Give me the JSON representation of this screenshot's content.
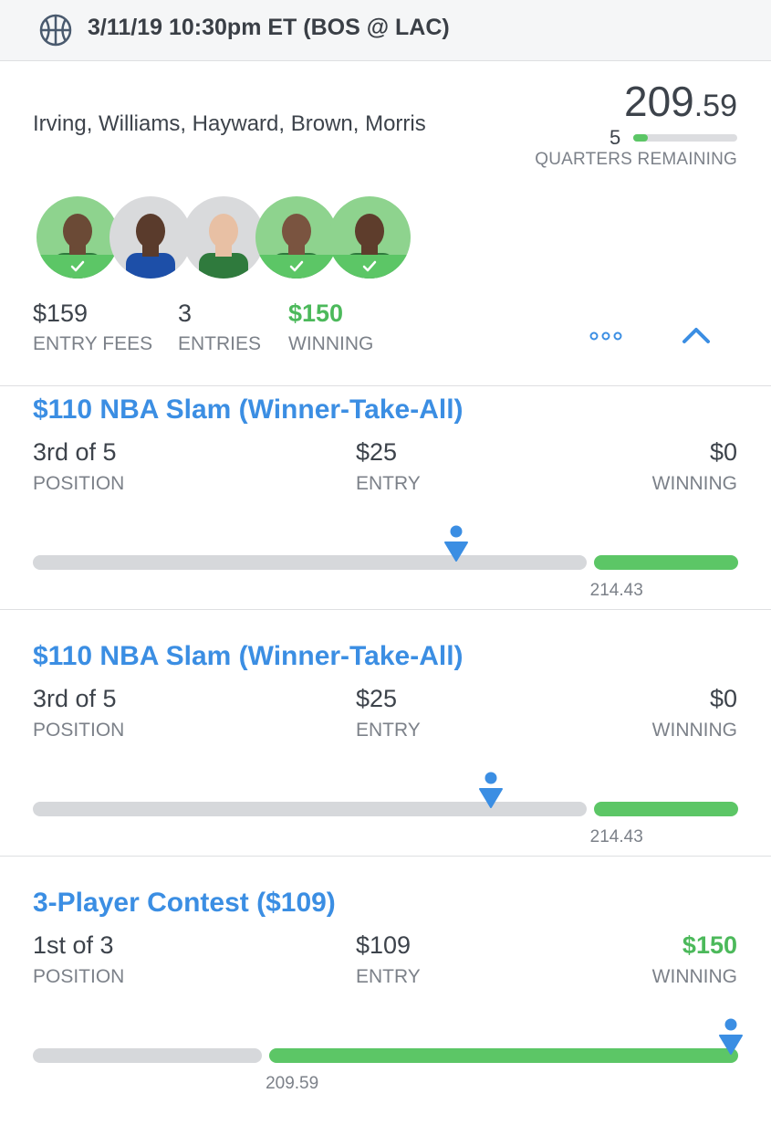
{
  "header": {
    "title": "3/11/19 10:30pm ET (BOS @ LAC)",
    "icon": "basketball-icon"
  },
  "lineup": {
    "players": "Irving, Williams, Hayward, Brown, Morris",
    "score_int": "209",
    "score_dec": ".59",
    "quarters_remaining": "5",
    "quarters_progress": 0.14,
    "quarters_label": "QUARTERS REMAINING",
    "avatars": [
      {
        "name": "player-irving",
        "bg": "#8ed38e",
        "checked": true
      },
      {
        "name": "player-williams",
        "bg": "#d9dadc",
        "checked": false
      },
      {
        "name": "player-hayward",
        "bg": "#d9dadc",
        "checked": false
      },
      {
        "name": "player-brown",
        "bg": "#8ed38e",
        "checked": true
      },
      {
        "name": "player-morris",
        "bg": "#8ed38e",
        "checked": true
      }
    ]
  },
  "summary": {
    "entry_fees": {
      "value": "$159",
      "label": "ENTRY FEES"
    },
    "entries": {
      "value": "3",
      "label": "ENTRIES"
    },
    "winning": {
      "value": "$150",
      "label": "WINNING"
    }
  },
  "contests": [
    {
      "title": "$110 NBA Slam (Winner-Take-All)",
      "position": "3rd of 5",
      "position_label": "POSITION",
      "entry": "$25",
      "entry_label": "ENTRY",
      "winning": "$0",
      "winning_label": "WINNING",
      "winning_green": false,
      "cutoff": "214.43",
      "cutoff_fraction": 0.79,
      "marker_fraction": 0.6
    },
    {
      "title": "$110 NBA Slam (Winner-Take-All)",
      "position": "3rd of 5",
      "position_label": "POSITION",
      "entry": "$25",
      "entry_label": "ENTRY",
      "winning": "$0",
      "winning_label": "WINNING",
      "winning_green": false,
      "cutoff": "214.43",
      "cutoff_fraction": 0.79,
      "marker_fraction": 0.65
    },
    {
      "title": "3-Player Contest ($109)",
      "position": "1st of 3",
      "position_label": "POSITION",
      "entry": "$109",
      "entry_label": "ENTRY",
      "winning": "$150",
      "winning_label": "WINNING",
      "winning_green": true,
      "cutoff": "209.59",
      "cutoff_fraction": 0.33,
      "marker_fraction": 0.99
    }
  ],
  "colors": {
    "accent": "#3b8ee3",
    "green": "#5cc666",
    "text": "#3d434b",
    "muted": "#7c8189"
  }
}
